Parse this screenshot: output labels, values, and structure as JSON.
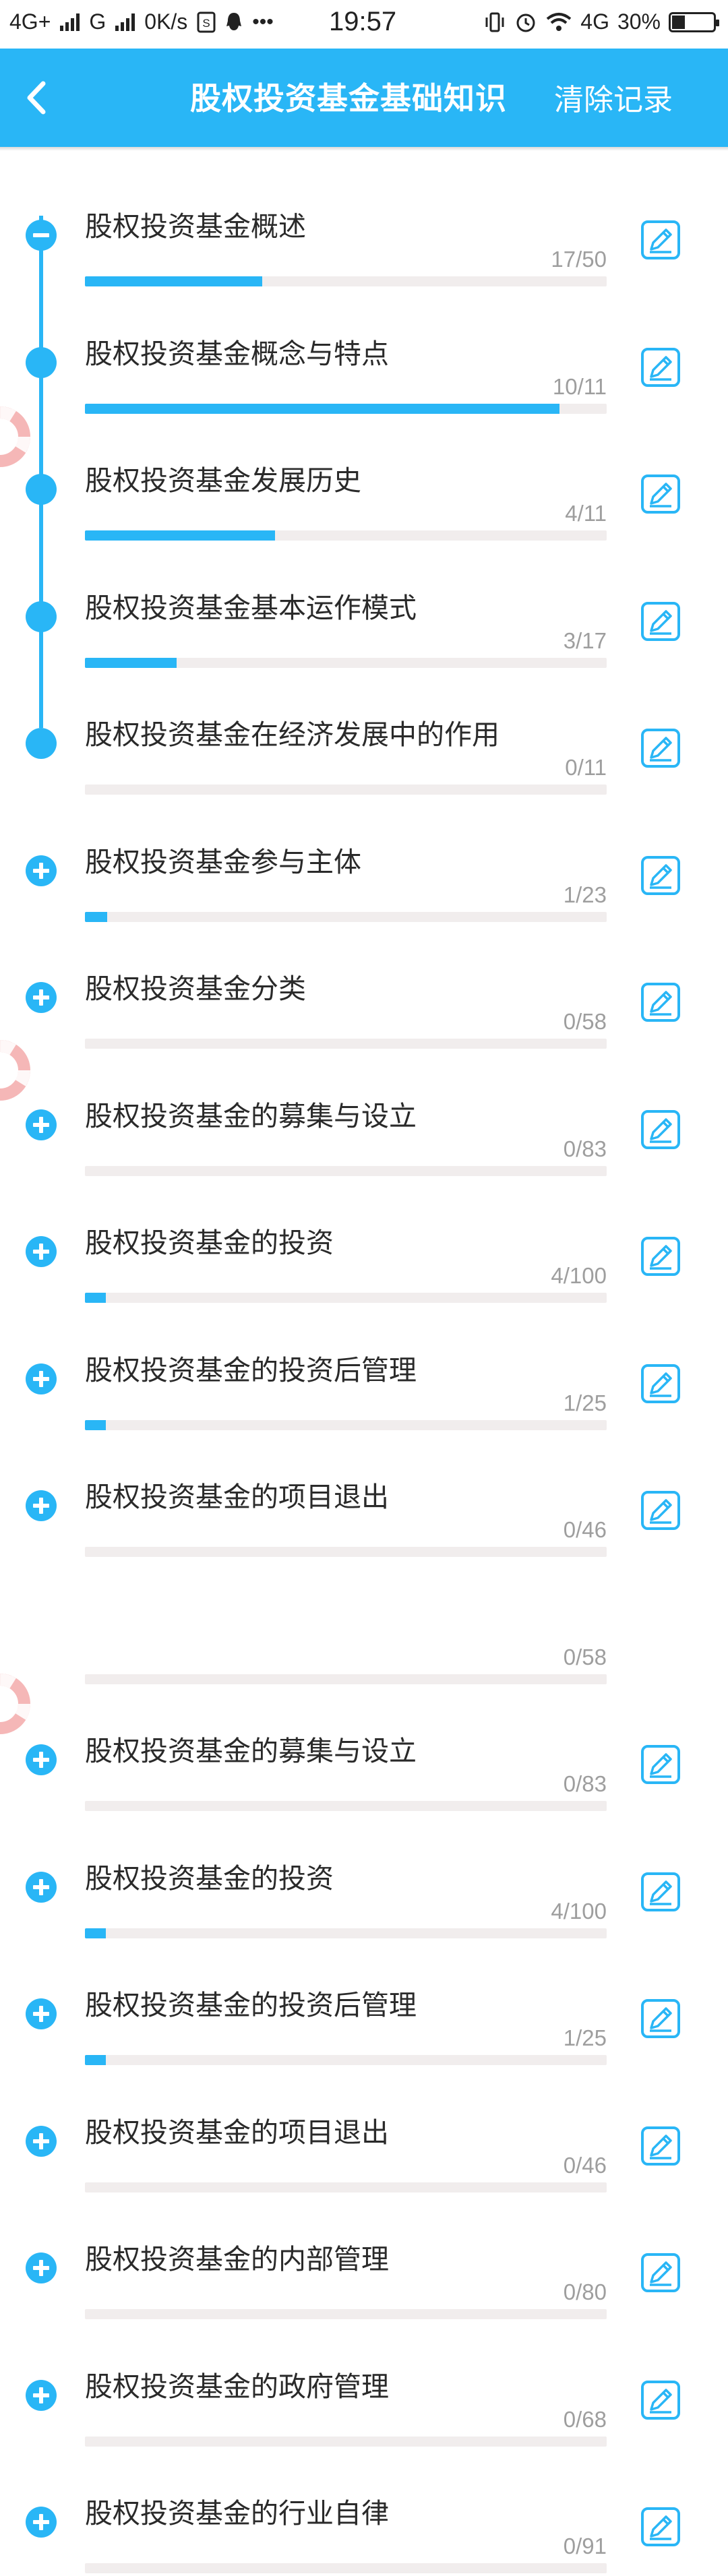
{
  "status": {
    "net1": "4G+",
    "net2": "G",
    "speed": "0K/s",
    "time": "19:57",
    "net3": "4G",
    "battery": "30%",
    "battery_level": 0.3
  },
  "header": {
    "title": "股权投资基金基础知识",
    "clear_label": "清除记录",
    "back_icon": "chevron-left-icon",
    "color": "#29b6f6"
  },
  "chapters": [
    {
      "title": "股权投资基金概述",
      "count": "17/50",
      "progress": 0.34,
      "expanded": true
    },
    {
      "title": "股权投资基金概念与特点",
      "count": "10/11",
      "progress": 0.909,
      "sub": true
    },
    {
      "title": "股权投资基金发展历史",
      "count": "4/11",
      "progress": 0.364,
      "sub": true
    },
    {
      "title": "股权投资基金基本运作模式",
      "count": "3/17",
      "progress": 0.176,
      "sub": true
    },
    {
      "title": "股权投资基金在经济发展中的作用",
      "count": "0/11",
      "progress": 0,
      "sub": true
    },
    {
      "title": "股权投资基金参与主体",
      "count": "1/23",
      "progress": 0.043
    },
    {
      "title": "股权投资基金分类",
      "count": "0/58",
      "progress": 0
    },
    {
      "title": "股权投资基金的募集与设立",
      "count": "0/83",
      "progress": 0
    },
    {
      "title": "股权投资基金的投资",
      "count": "4/100",
      "progress": 0.04
    },
    {
      "title": "股权投资基金的投资后管理",
      "count": "1/25",
      "progress": 0.04
    },
    {
      "title": "股权投资基金的项目退出",
      "count": "0/46",
      "progress": 0
    },
    {
      "title": "",
      "count": "0/58",
      "progress": 0,
      "partial": true
    },
    {
      "title": "股权投资基金的募集与设立",
      "count": "0/83",
      "progress": 0
    },
    {
      "title": "股权投资基金的投资",
      "count": "4/100",
      "progress": 0.04
    },
    {
      "title": "股权投资基金的投资后管理",
      "count": "1/25",
      "progress": 0.04
    },
    {
      "title": "股权投资基金的项目退出",
      "count": "0/46",
      "progress": 0
    },
    {
      "title": "股权投资基金的内部管理",
      "count": "0/80",
      "progress": 0
    },
    {
      "title": "股权投资基金的政府管理",
      "count": "0/68",
      "progress": 0
    },
    {
      "title": "股权投资基金的行业自律",
      "count": "0/91",
      "progress": 0
    }
  ]
}
